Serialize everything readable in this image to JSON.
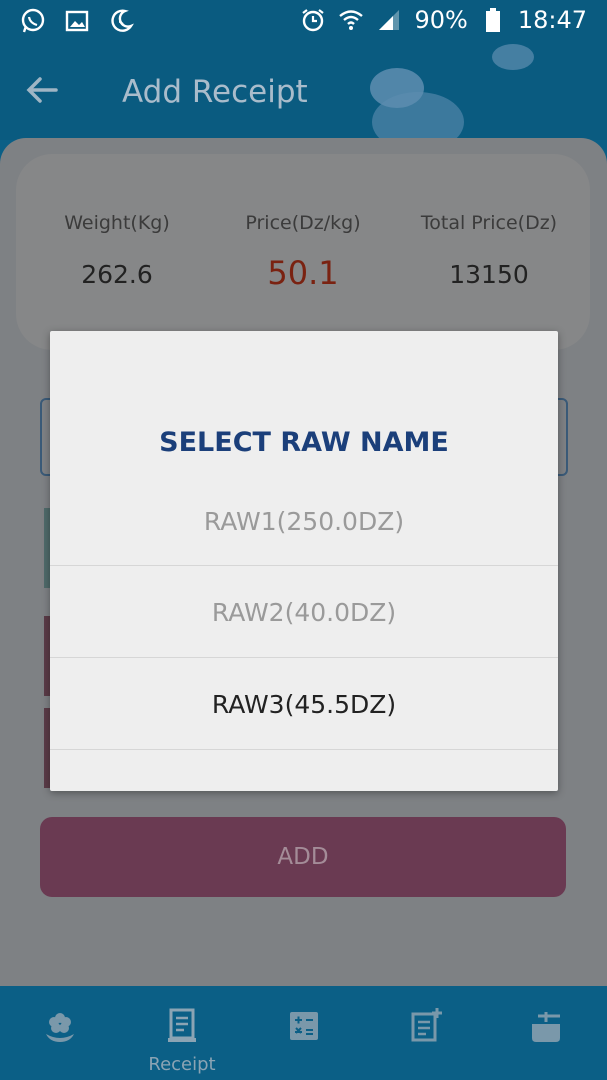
{
  "status_bar": {
    "battery": "90%",
    "time": "18:47"
  },
  "app_bar": {
    "title": "Add Receipt"
  },
  "summary": {
    "weight_label": "Weight(Kg)",
    "weight_value": "262.6",
    "price_label": "Price(Dz/kg)",
    "price_value": "50.1",
    "total_label": "Total Price(Dz)",
    "total_value": "13150"
  },
  "add_button": {
    "label": "ADD"
  },
  "dialog": {
    "title": "SELECT RAW NAME",
    "options": [
      {
        "label": "RAW1(250.0DZ)"
      },
      {
        "label": "RAW2(40.0DZ)"
      },
      {
        "label": "RAW3(45.5DZ)"
      }
    ]
  },
  "bottom_nav": {
    "items": [
      {
        "icon": "flower-icon",
        "label": ""
      },
      {
        "icon": "receipt-icon",
        "label": "Receipt"
      },
      {
        "icon": "calculator-icon",
        "label": ""
      },
      {
        "icon": "note-add-icon",
        "label": ""
      },
      {
        "icon": "pot-icon",
        "label": ""
      }
    ]
  },
  "colors": {
    "primary": "#0b5f86",
    "dialog_title": "#1b3f7a",
    "price_value": "#7a2211",
    "add_button": "#6a3a52"
  }
}
